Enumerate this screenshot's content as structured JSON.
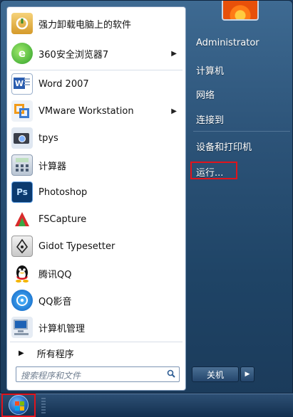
{
  "pinned": [
    {
      "label": "强力卸载电脑上的软件",
      "icon": "uninstaller-box-icon",
      "submenu": false
    },
    {
      "label": "360安全浏览器7",
      "icon": "360-browser-icon",
      "submenu": true
    }
  ],
  "recent": [
    {
      "label": "Word 2007",
      "icon": "word-document-icon",
      "submenu": false
    },
    {
      "label": "VMware Workstation",
      "icon": "vmware-icon",
      "submenu": true
    },
    {
      "label": "tpys",
      "icon": "camera-icon",
      "submenu": false
    },
    {
      "label": "计算器",
      "icon": "calculator-icon",
      "submenu": false
    },
    {
      "label": "Photoshop",
      "icon": "photoshop-icon",
      "submenu": false
    },
    {
      "label": "FSCapture",
      "icon": "fscapture-icon",
      "submenu": false
    },
    {
      "label": "Gidot Typesetter",
      "icon": "pen-nib-icon",
      "submenu": false
    },
    {
      "label": "腾讯QQ",
      "icon": "qq-penguin-icon",
      "submenu": false
    },
    {
      "label": "QQ影音",
      "icon": "qq-player-icon",
      "submenu": false
    },
    {
      "label": "计算机管理",
      "icon": "computer-management-icon",
      "submenu": false
    }
  ],
  "all_programs": "所有程序",
  "search": {
    "placeholder": "搜索程序和文件"
  },
  "right": {
    "user": "Administrator",
    "items": [
      "计算机",
      "网络",
      "连接到",
      "设备和打印机",
      "运行..."
    ]
  },
  "shutdown": {
    "label": "关机"
  },
  "colors": {
    "highlight": "#e0141c",
    "menu_blue": "#2c5378"
  }
}
